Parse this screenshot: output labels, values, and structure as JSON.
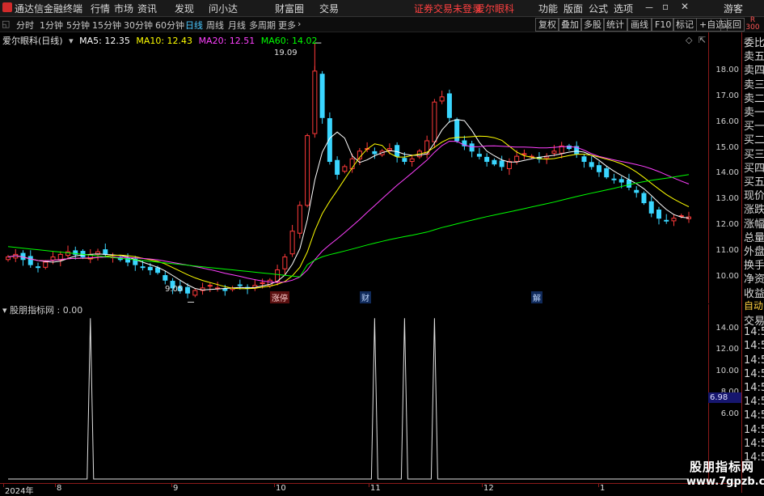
{
  "menubar": {
    "app_title": "通达信金融终端",
    "items": [
      "行情",
      "市场",
      "资讯",
      "发现",
      "问小达",
      "财富圈",
      "交易"
    ],
    "login_status": "证券交易未登录",
    "stock_name": "爱尔眼科",
    "right_items": [
      "功能",
      "版面",
      "公式",
      "选项"
    ],
    "user": "游客"
  },
  "tabs": {
    "items": [
      "分时",
      "1分钟",
      "5分钟",
      "15分钟",
      "30分钟",
      "60分钟",
      "日线",
      "周线",
      "月线",
      "多周期",
      "更多"
    ],
    "active": "日线"
  },
  "toolbar": {
    "buttons": [
      "复权",
      "叠加",
      "多股",
      "统计",
      "画线",
      "F10",
      "标记",
      "+自选",
      "返回"
    ]
  },
  "right_top": {
    "line1": "R",
    "line2": "300"
  },
  "legend": {
    "title": "爱尔眼科(日线)",
    "ma5": "MA5: 12.35",
    "ma10": "MA10: 12.43",
    "ma20": "MA20: 12.51",
    "ma60": "MA60: 14.02",
    "colors": {
      "ma5": "#ffffff",
      "ma10": "#ffff00",
      "ma20": "#ff40ff",
      "ma60": "#00ff00"
    }
  },
  "annotations": {
    "high": "19.09",
    "low": "9.05",
    "markers": [
      "涨停",
      "财",
      "解"
    ]
  },
  "price_scale": [
    "18.00",
    "17.00",
    "16.00",
    "15.00",
    "14.00",
    "13.00",
    "12.00",
    "11.00",
    "10.00"
  ],
  "indicator": {
    "legend": "股朋指标网 : 0.00",
    "scale": [
      "14.00",
      "12.00",
      "10.00",
      "8.00",
      "6.00"
    ],
    "current_value": "6.98"
  },
  "x_axis": [
    "2024年",
    "8",
    "9",
    "10",
    "11",
    "12",
    "1"
  ],
  "right_panel": {
    "labels": [
      "委比",
      "卖五",
      "卖四",
      "卖三",
      "卖二",
      "卖一",
      "买一",
      "买二",
      "买三",
      "买四",
      "买五",
      "现价",
      "涨跌",
      "涨幅",
      "总量",
      "外盘",
      "换手",
      "净资",
      "收益",
      "自动",
      "交易",
      "14:5",
      "14:5",
      "14:5",
      "14:5",
      "14:5",
      "14:5",
      "14:5",
      "14:5",
      "14:5",
      "14:5"
    ]
  },
  "watermark": {
    "line1": "股朋指标网",
    "line2": "www.7gpzb.com"
  },
  "chart_data": [
    {
      "type": "candlestick",
      "title": "爱尔眼科(日线)",
      "ylim": [
        9.0,
        19.5
      ],
      "series_ma": [
        {
          "name": "MA5",
          "last": 12.35
        },
        {
          "name": "MA10",
          "last": 12.43
        },
        {
          "name": "MA20",
          "last": 12.51
        },
        {
          "name": "MA60",
          "last": 14.02
        }
      ],
      "close": [
        10.8,
        10.9,
        10.7,
        10.5,
        10.4,
        10.6,
        10.8,
        10.9,
        11.0,
        10.9,
        10.8,
        10.9,
        11.0,
        10.9,
        10.8,
        10.7,
        10.6,
        10.5,
        10.4,
        10.3,
        10.2,
        9.9,
        9.6,
        9.5,
        9.4,
        9.5,
        9.6,
        9.7,
        9.6,
        9.5,
        9.6,
        9.7,
        9.6,
        9.7,
        9.8,
        9.9,
        10.3,
        10.8,
        11.8,
        12.8,
        15.5,
        18.0,
        16.2,
        14.5,
        14.0,
        14.3,
        14.6,
        14.9,
        15.0,
        14.8,
        14.9,
        15.0,
        14.7,
        14.5,
        14.6,
        14.9,
        15.3,
        16.8,
        17.0,
        16.2,
        15.3,
        15.1,
        14.9,
        14.7,
        14.5,
        14.4,
        14.3,
        14.5,
        14.7,
        14.8,
        14.7,
        14.6,
        14.7,
        14.9,
        15.1,
        15.0,
        14.8,
        14.5,
        14.3,
        14.1,
        13.9,
        13.8,
        13.7,
        13.5,
        13.3,
        12.9,
        12.5,
        12.3,
        12.2,
        12.3,
        12.4,
        12.35
      ]
    },
    {
      "type": "line",
      "title": "股朋指标网",
      "ylim": [
        0,
        16
      ],
      "spikes_at_index": [
        11,
        49,
        53,
        57
      ],
      "spike_value": 15.0
    }
  ]
}
